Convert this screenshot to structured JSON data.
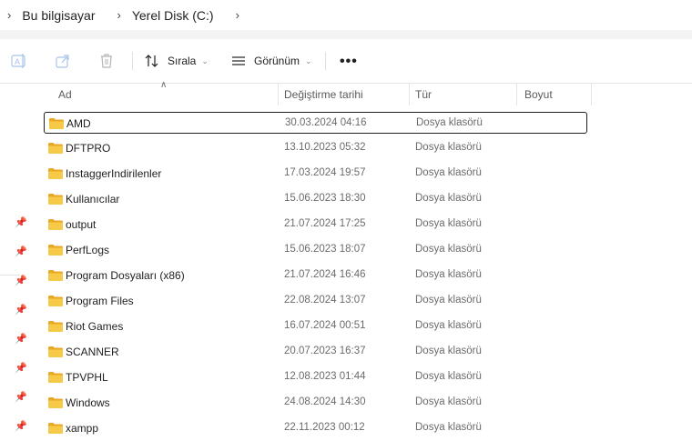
{
  "address_bar": {
    "breadcrumbs": [
      "Bu bilgisayar",
      "Yerel Disk (C:)"
    ]
  },
  "toolbar": {
    "sort_label": "Sırala",
    "view_label": "Görünüm",
    "more_label": "•••"
  },
  "columns": {
    "name": "Ad",
    "date": "Değiştirme tarihi",
    "type": "Tür",
    "size": "Boyut"
  },
  "files": [
    {
      "name": "AMD",
      "date": "30.03.2024 04:16",
      "type": "Dosya klasörü",
      "selected": true
    },
    {
      "name": "DFTPRO",
      "date": "13.10.2023 05:32",
      "type": "Dosya klasörü"
    },
    {
      "name": "InstaggerIndirilenler",
      "date": "17.03.2024 19:57",
      "type": "Dosya klasörü"
    },
    {
      "name": "Kullanıcılar",
      "date": "15.06.2023 18:30",
      "type": "Dosya klasörü"
    },
    {
      "name": "output",
      "date": "21.07.2024 17:25",
      "type": "Dosya klasörü"
    },
    {
      "name": "PerfLogs",
      "date": "15.06.2023 18:07",
      "type": "Dosya klasörü"
    },
    {
      "name": "Program Dosyaları (x86)",
      "date": "21.07.2024 16:46",
      "type": "Dosya klasörü"
    },
    {
      "name": "Program Files",
      "date": "22.08.2024 13:07",
      "type": "Dosya klasörü"
    },
    {
      "name": "Riot Games",
      "date": "16.07.2024 00:51",
      "type": "Dosya klasörü"
    },
    {
      "name": "SCANNER",
      "date": "20.07.2023 16:37",
      "type": "Dosya klasörü"
    },
    {
      "name": "TPVPHL",
      "date": "12.08.2023 01:44",
      "type": "Dosya klasörü"
    },
    {
      "name": "Windows",
      "date": "24.08.2024 14:30",
      "type": "Dosya klasörü"
    },
    {
      "name": "xampp",
      "date": "22.11.2023 00:12",
      "type": "Dosya klasörü"
    }
  ],
  "colors": {
    "folder": "#f7c948",
    "folder_dark": "#e9a825",
    "selection_border": "#1f1f1f"
  }
}
